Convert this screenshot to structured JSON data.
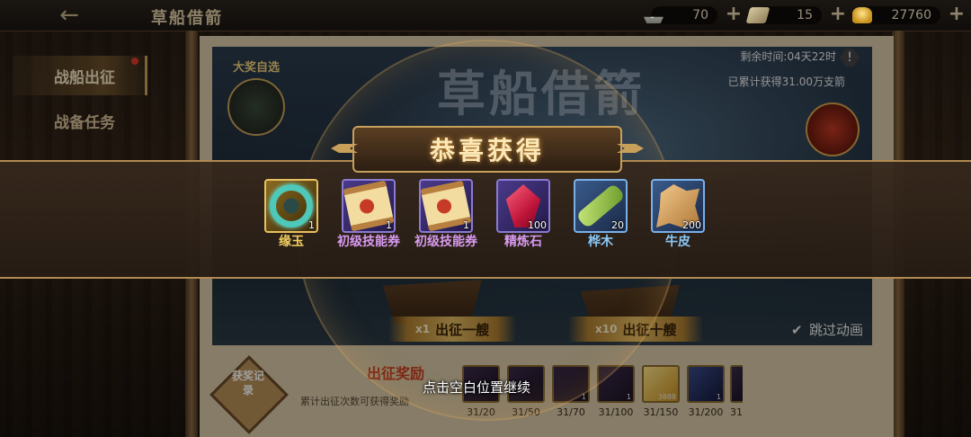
{
  "header": {
    "title": "草船借箭",
    "resources": [
      {
        "icon": "boat-icon",
        "value": "70"
      },
      {
        "icon": "ticket-icon",
        "value": "15"
      },
      {
        "icon": "gold-ingot-icon",
        "value": "27760"
      }
    ]
  },
  "sidebar": {
    "items": [
      {
        "label": "战船出征",
        "active": true
      },
      {
        "label": "战备任务",
        "active": false
      }
    ]
  },
  "event": {
    "banner_title": "草船借箭",
    "time_left": "剩余时间:04天22时",
    "accumulated": "已累计获得31.00万支箭",
    "grand_prize_label": "大奖自选",
    "launch_one": {
      "multiplier": "x1",
      "label": "出征一艘"
    },
    "launch_ten": {
      "multiplier": "x10",
      "label": "出征十艘"
    },
    "skip_animation": "跳过动画"
  },
  "rewards_strip": {
    "title": "出征奖励",
    "subtitle": "累计出征次数可获得奖励",
    "record_button": "获奖记录",
    "milestones": [
      "31/20",
      "31/50",
      "31/70",
      "31/100",
      "31/150",
      "31/200",
      "31"
    ],
    "milestone_counts": [
      "",
      "",
      "1",
      "1",
      "3888",
      "1",
      ""
    ]
  },
  "popup": {
    "title": "恭喜获得",
    "items": [
      {
        "name": "缘玉",
        "qty": "1",
        "rarity": "gold",
        "icon": "jade-ring-icon"
      },
      {
        "name": "初级技能券",
        "qty": "1",
        "rarity": "purple",
        "icon": "scroll-icon"
      },
      {
        "name": "初级技能券",
        "qty": "1",
        "rarity": "purple",
        "icon": "scroll-icon"
      },
      {
        "name": "精炼石",
        "qty": "100",
        "rarity": "purple",
        "icon": "red-crystal-icon"
      },
      {
        "name": "桦木",
        "qty": "20",
        "rarity": "blue",
        "icon": "wood-log-icon"
      },
      {
        "name": "牛皮",
        "qty": "200",
        "rarity": "blue",
        "icon": "hide-icon"
      }
    ],
    "continue_hint": "点击空白位置继续"
  },
  "colors": {
    "gold": "#f2d060",
    "purple": "#d89af0",
    "blue": "#8ac8f8",
    "notify_red": "#e03a2a"
  }
}
